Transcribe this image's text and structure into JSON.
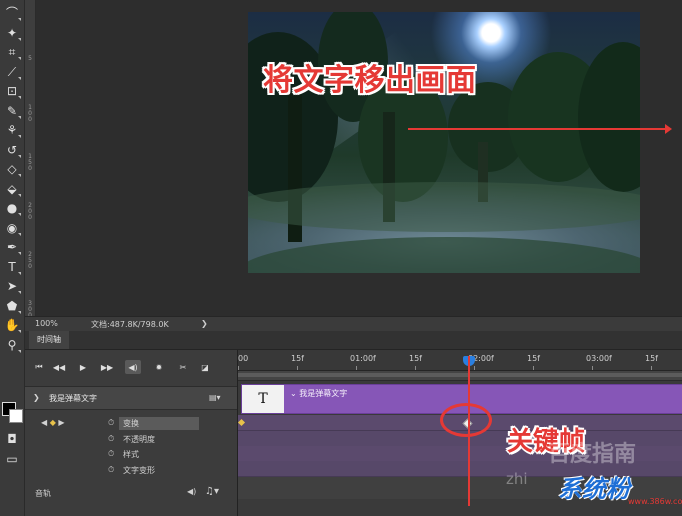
{
  "tools": [
    {
      "name": "lasso-icon",
      "glyph": "⌒"
    },
    {
      "name": "magic-wand-icon",
      "glyph": "✦"
    },
    {
      "name": "crop-icon",
      "glyph": "⌗"
    },
    {
      "name": "eyedropper-icon",
      "glyph": "⟋"
    },
    {
      "name": "frame-icon",
      "glyph": "⊡"
    },
    {
      "name": "brush-icon",
      "glyph": "✎"
    },
    {
      "name": "clone-stamp-icon",
      "glyph": "⚘"
    },
    {
      "name": "history-brush-icon",
      "glyph": "↺"
    },
    {
      "name": "eraser-icon",
      "glyph": "◇"
    },
    {
      "name": "paint-bucket-icon",
      "glyph": "⬙"
    },
    {
      "name": "blur-icon",
      "glyph": "●"
    },
    {
      "name": "dodge-icon",
      "glyph": "◉"
    },
    {
      "name": "pen-icon",
      "glyph": "✒"
    },
    {
      "name": "type-icon",
      "glyph": "T"
    },
    {
      "name": "path-selection-icon",
      "glyph": "➤"
    },
    {
      "name": "shape-icon",
      "glyph": "⬟"
    },
    {
      "name": "hand-icon",
      "glyph": "✋"
    },
    {
      "name": "zoom-icon",
      "glyph": "⚲"
    }
  ],
  "ruler_numbers": [
    "5",
    "1\n0\n0",
    "1\n5\n0",
    "2\n0\n0",
    "2\n5\n0",
    "3\n0\n0",
    "3\n5\n0"
  ],
  "canvas": {
    "overlay_text": "将文字移出画面"
  },
  "status": {
    "zoom": "100%",
    "doc_info": "文档:487.8K/798.0K",
    "arrow": "❯"
  },
  "timeline": {
    "tab_label": "时间轴",
    "controls": [
      {
        "name": "first-frame-button",
        "glyph": "⏮"
      },
      {
        "name": "prev-frame-button",
        "glyph": "◀◀"
      },
      {
        "name": "play-button",
        "glyph": "▶"
      },
      {
        "name": "next-frame-button",
        "glyph": "▶▶"
      },
      {
        "name": "audio-toggle-button",
        "glyph": "◀)"
      },
      {
        "name": "settings-button",
        "glyph": "✹"
      },
      {
        "name": "split-scissors-button",
        "glyph": "✂"
      },
      {
        "name": "transition-button",
        "glyph": "◪"
      }
    ],
    "layer_name": "我是弹幕文字",
    "properties": [
      "变换",
      "不透明度",
      "样式",
      "文字变形"
    ],
    "audio_label": "音轨",
    "ruler_labels": [
      "00",
      "15f",
      "01:00f",
      "15f",
      "02:00f",
      "15f",
      "03:00f",
      "15f"
    ],
    "clip_thumb": "T",
    "clip_label": "我是弹幕文字",
    "keyframe_annotation": "关键帧"
  },
  "watermarks": {
    "baidu": "百度指南",
    "zhihu": "zhi",
    "logo": "系统粉",
    "url": "www.386w.com"
  },
  "colors": {
    "accent_red": "#e53935",
    "clip_purple": "#8656b7",
    "playhead_blue": "#2a7fe0"
  }
}
